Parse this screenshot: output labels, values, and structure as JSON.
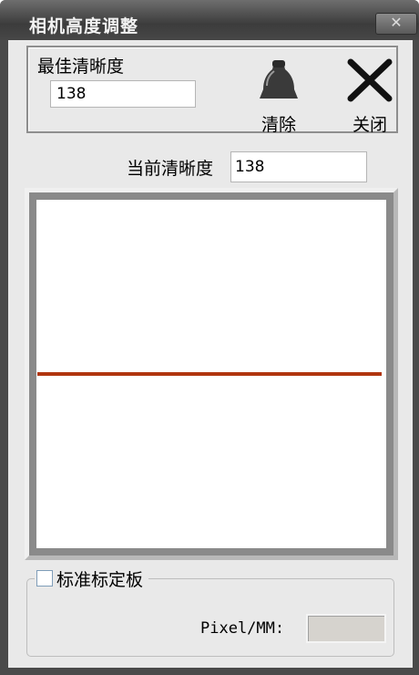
{
  "window": {
    "title": "相机高度调整",
    "close_icon": "close-x-icon"
  },
  "best_clarity": {
    "label": "最佳清晰度",
    "value": "138"
  },
  "toolbar": {
    "clear_label": "清除",
    "clear_icon": "bell-icon",
    "close_label": "关闭",
    "close_icon": "x-icon"
  },
  "current_clarity": {
    "label": "当前清晰度",
    "value": "138"
  },
  "plot": {
    "line_color": "#b0350f",
    "frame_color": "#8a8a8a",
    "level": 0.5
  },
  "calibration": {
    "checkbox_label": "标准标定板",
    "checked": false,
    "pixel_mm_label": "Pixel/MM:",
    "pixel_mm_value": ""
  }
}
